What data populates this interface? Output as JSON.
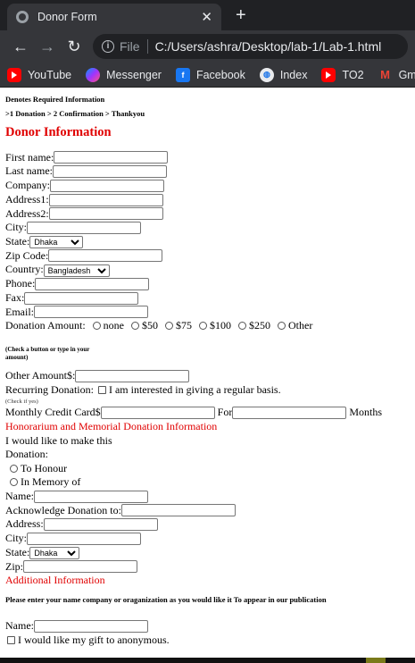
{
  "browser": {
    "tab_title": "Donor Form",
    "tab_close": "✕",
    "new_tab": "+",
    "nav": {
      "back": "←",
      "forward": "→",
      "reload": "↻"
    },
    "omnibox": {
      "info": "i",
      "scheme": "File",
      "url": "C:/Users/ashra/Desktop/lab-1/Lab-1.html"
    },
    "bookmarks": [
      {
        "label": "YouTube",
        "icon": "youtube-icon"
      },
      {
        "label": "Messenger",
        "icon": "messenger-icon"
      },
      {
        "label": "Facebook",
        "icon": "facebook-icon"
      },
      {
        "label": "Index",
        "icon": "index-icon"
      },
      {
        "label": "TO2",
        "icon": "youtube-icon"
      },
      {
        "label": "Gma",
        "icon": "gmail-icon"
      }
    ]
  },
  "page": {
    "required_note": "Denotes Required Information",
    "steps": ">1 Donation > 2 Confirmation > Thankyou",
    "section_title": "Donor Information",
    "fields": {
      "first_name": "First name:",
      "last_name": "Last name:",
      "company": "Company:",
      "address1": "Address1:",
      "address2": "Address2:",
      "city": "City:",
      "state": "State:",
      "state_value": "Dhaka",
      "zip": "Zip Code:",
      "country": "Country:",
      "country_value": "Bangladesh",
      "phone": "Phone:",
      "fax": "Fax:",
      "email": "Email:"
    },
    "donation": {
      "label": "Donation Amount:",
      "options": [
        "none",
        "$50",
        "$75",
        "$100",
        "$250",
        "Other"
      ],
      "hint": "(Check a button or type in your amount)",
      "other_amount": "Other Amount$:",
      "recurring_label": "Recurring Donation:",
      "recurring_text": "I am interested in giving a regular basis.",
      "check_hint": "(Check if yes)",
      "monthly_label": "Monthly Credit Card$",
      "for_label": "For",
      "months_label": "Months"
    },
    "honorarium": {
      "title": "Honorarium and Memorial Donation Information",
      "intro_line1": "I would like to make this",
      "intro_line2": "Donation:",
      "options": [
        "To Honour",
        "In Memory of"
      ],
      "name": "Name:",
      "acknowledge": "Acknowledge Donation to:",
      "address": "Address:",
      "city": "City:",
      "state": "State:",
      "state_value": "Dhaka",
      "zip": "Zip:"
    },
    "additional": {
      "title": "Additional Information",
      "note": "Please enter your name company or oraganization as you would like it To appear in our publication",
      "name": "Name:",
      "anonymous": "I would like my gift to anonymous."
    }
  }
}
